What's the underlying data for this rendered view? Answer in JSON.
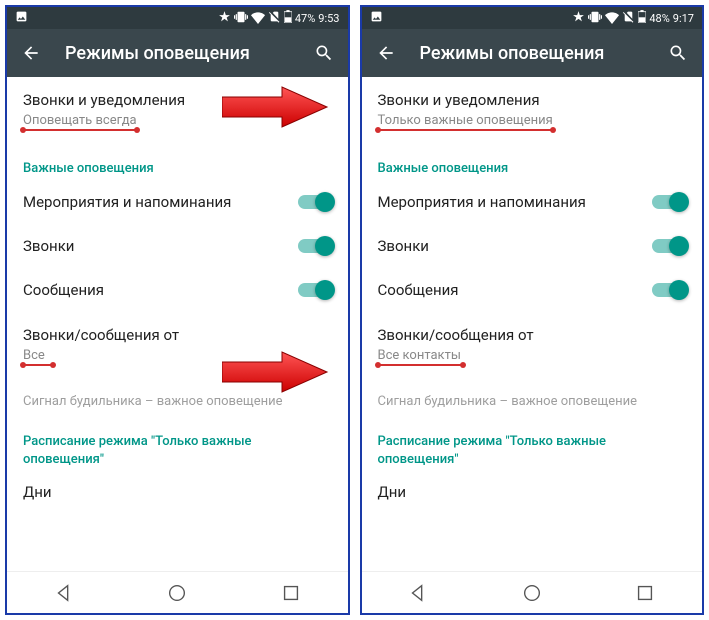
{
  "left": {
    "statusbar": {
      "battery": "47%",
      "time": "9:53"
    },
    "appbar": {
      "title": "Режимы оповещения"
    },
    "calls_notif": {
      "title": "Звонки и уведомления",
      "sub": "Оповещать всегда"
    },
    "section_important": "Важные оповещения",
    "toggles": {
      "events": "Мероприятия и напоминания",
      "calls": "Звонки",
      "messages": "Сообщения"
    },
    "calls_from": {
      "title": "Звонки/сообщения от",
      "sub": "Все"
    },
    "alarm_hint": "Сигнал будильника – важное оповещение",
    "schedule_header": "Расписание режима \"Только важные оповещения\"",
    "days": "Дни"
  },
  "right": {
    "statusbar": {
      "battery": "48%",
      "time": "9:17"
    },
    "appbar": {
      "title": "Режимы оповещения"
    },
    "calls_notif": {
      "title": "Звонки и уведомления",
      "sub": "Только важные оповещения"
    },
    "section_important": "Важные оповещения",
    "toggles": {
      "events": "Мероприятия и напоминания",
      "calls": "Звонки",
      "messages": "Сообщения"
    },
    "calls_from": {
      "title": "Звонки/сообщения от",
      "sub": "Все контакты"
    },
    "alarm_hint": "Сигнал будильника – важное оповещение",
    "schedule_header": "Расписание режима \"Только важные оповещения\"",
    "days": "Дни"
  }
}
